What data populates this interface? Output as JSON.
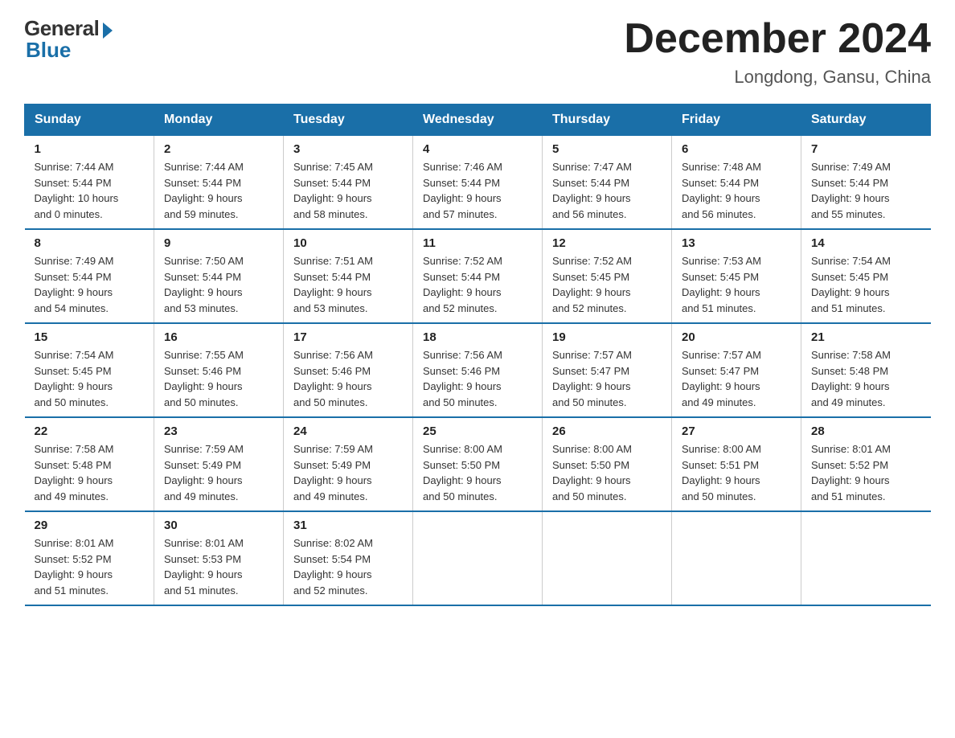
{
  "header": {
    "logo_general": "General",
    "logo_blue": "Blue",
    "title": "December 2024",
    "location": "Longdong, Gansu, China"
  },
  "columns": [
    "Sunday",
    "Monday",
    "Tuesday",
    "Wednesday",
    "Thursday",
    "Friday",
    "Saturday"
  ],
  "weeks": [
    [
      {
        "day": "1",
        "sunrise": "7:44 AM",
        "sunset": "5:44 PM",
        "daylight": "10 hours and 0 minutes."
      },
      {
        "day": "2",
        "sunrise": "7:44 AM",
        "sunset": "5:44 PM",
        "daylight": "9 hours and 59 minutes."
      },
      {
        "day": "3",
        "sunrise": "7:45 AM",
        "sunset": "5:44 PM",
        "daylight": "9 hours and 58 minutes."
      },
      {
        "day": "4",
        "sunrise": "7:46 AM",
        "sunset": "5:44 PM",
        "daylight": "9 hours and 57 minutes."
      },
      {
        "day": "5",
        "sunrise": "7:47 AM",
        "sunset": "5:44 PM",
        "daylight": "9 hours and 56 minutes."
      },
      {
        "day": "6",
        "sunrise": "7:48 AM",
        "sunset": "5:44 PM",
        "daylight": "9 hours and 56 minutes."
      },
      {
        "day": "7",
        "sunrise": "7:49 AM",
        "sunset": "5:44 PM",
        "daylight": "9 hours and 55 minutes."
      }
    ],
    [
      {
        "day": "8",
        "sunrise": "7:49 AM",
        "sunset": "5:44 PM",
        "daylight": "9 hours and 54 minutes."
      },
      {
        "day": "9",
        "sunrise": "7:50 AM",
        "sunset": "5:44 PM",
        "daylight": "9 hours and 53 minutes."
      },
      {
        "day": "10",
        "sunrise": "7:51 AM",
        "sunset": "5:44 PM",
        "daylight": "9 hours and 53 minutes."
      },
      {
        "day": "11",
        "sunrise": "7:52 AM",
        "sunset": "5:44 PM",
        "daylight": "9 hours and 52 minutes."
      },
      {
        "day": "12",
        "sunrise": "7:52 AM",
        "sunset": "5:45 PM",
        "daylight": "9 hours and 52 minutes."
      },
      {
        "day": "13",
        "sunrise": "7:53 AM",
        "sunset": "5:45 PM",
        "daylight": "9 hours and 51 minutes."
      },
      {
        "day": "14",
        "sunrise": "7:54 AM",
        "sunset": "5:45 PM",
        "daylight": "9 hours and 51 minutes."
      }
    ],
    [
      {
        "day": "15",
        "sunrise": "7:54 AM",
        "sunset": "5:45 PM",
        "daylight": "9 hours and 50 minutes."
      },
      {
        "day": "16",
        "sunrise": "7:55 AM",
        "sunset": "5:46 PM",
        "daylight": "9 hours and 50 minutes."
      },
      {
        "day": "17",
        "sunrise": "7:56 AM",
        "sunset": "5:46 PM",
        "daylight": "9 hours and 50 minutes."
      },
      {
        "day": "18",
        "sunrise": "7:56 AM",
        "sunset": "5:46 PM",
        "daylight": "9 hours and 50 minutes."
      },
      {
        "day": "19",
        "sunrise": "7:57 AM",
        "sunset": "5:47 PM",
        "daylight": "9 hours and 50 minutes."
      },
      {
        "day": "20",
        "sunrise": "7:57 AM",
        "sunset": "5:47 PM",
        "daylight": "9 hours and 49 minutes."
      },
      {
        "day": "21",
        "sunrise": "7:58 AM",
        "sunset": "5:48 PM",
        "daylight": "9 hours and 49 minutes."
      }
    ],
    [
      {
        "day": "22",
        "sunrise": "7:58 AM",
        "sunset": "5:48 PM",
        "daylight": "9 hours and 49 minutes."
      },
      {
        "day": "23",
        "sunrise": "7:59 AM",
        "sunset": "5:49 PM",
        "daylight": "9 hours and 49 minutes."
      },
      {
        "day": "24",
        "sunrise": "7:59 AM",
        "sunset": "5:49 PM",
        "daylight": "9 hours and 49 minutes."
      },
      {
        "day": "25",
        "sunrise": "8:00 AM",
        "sunset": "5:50 PM",
        "daylight": "9 hours and 50 minutes."
      },
      {
        "day": "26",
        "sunrise": "8:00 AM",
        "sunset": "5:50 PM",
        "daylight": "9 hours and 50 minutes."
      },
      {
        "day": "27",
        "sunrise": "8:00 AM",
        "sunset": "5:51 PM",
        "daylight": "9 hours and 50 minutes."
      },
      {
        "day": "28",
        "sunrise": "8:01 AM",
        "sunset": "5:52 PM",
        "daylight": "9 hours and 51 minutes."
      }
    ],
    [
      {
        "day": "29",
        "sunrise": "8:01 AM",
        "sunset": "5:52 PM",
        "daylight": "9 hours and 51 minutes."
      },
      {
        "day": "30",
        "sunrise": "8:01 AM",
        "sunset": "5:53 PM",
        "daylight": "9 hours and 51 minutes."
      },
      {
        "day": "31",
        "sunrise": "8:02 AM",
        "sunset": "5:54 PM",
        "daylight": "9 hours and 52 minutes."
      },
      null,
      null,
      null,
      null
    ]
  ],
  "labels": {
    "sunrise": "Sunrise:",
    "sunset": "Sunset:",
    "daylight": "Daylight:"
  }
}
